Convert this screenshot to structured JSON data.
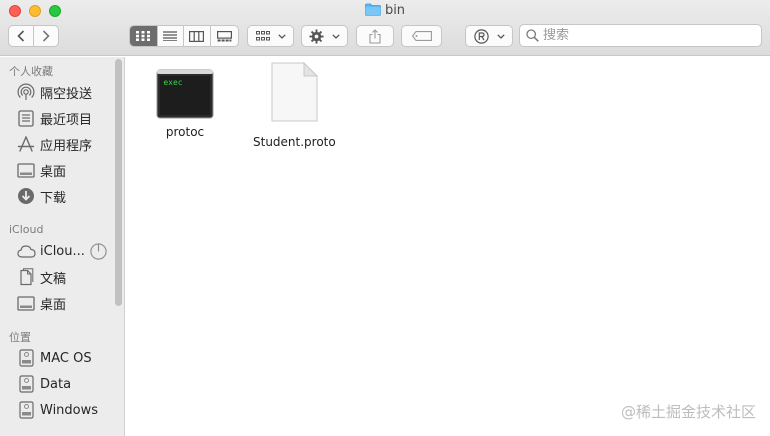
{
  "window": {
    "title": "bin"
  },
  "toolbar": {
    "search_placeholder": "搜索"
  },
  "sidebar": {
    "sections": [
      {
        "title": "个人收藏"
      },
      {
        "title": "iCloud"
      },
      {
        "title": "位置"
      }
    ],
    "favorites": [
      {
        "label": "隔空投送",
        "icon": "airdrop-icon"
      },
      {
        "label": "最近项目",
        "icon": "recents-icon"
      },
      {
        "label": "应用程序",
        "icon": "applications-icon"
      },
      {
        "label": "桌面",
        "icon": "desktop-icon"
      },
      {
        "label": "下载",
        "icon": "downloads-icon"
      }
    ],
    "icloud": [
      {
        "label": "iClou...",
        "icon": "cloud-icon"
      },
      {
        "label": "文稿",
        "icon": "document-icon"
      },
      {
        "label": "桌面",
        "icon": "desktop-icon"
      }
    ],
    "locations": [
      {
        "label": "MAC OS",
        "icon": "disk-icon"
      },
      {
        "label": "Data",
        "icon": "disk-icon"
      },
      {
        "label": "Windows",
        "icon": "disk-icon"
      }
    ]
  },
  "files": [
    {
      "name": "protoc",
      "icon_text": "exec",
      "type": "executable"
    },
    {
      "name": "Student.proto",
      "type": "document"
    }
  ],
  "watermark": "@稀土掘金技术社区"
}
